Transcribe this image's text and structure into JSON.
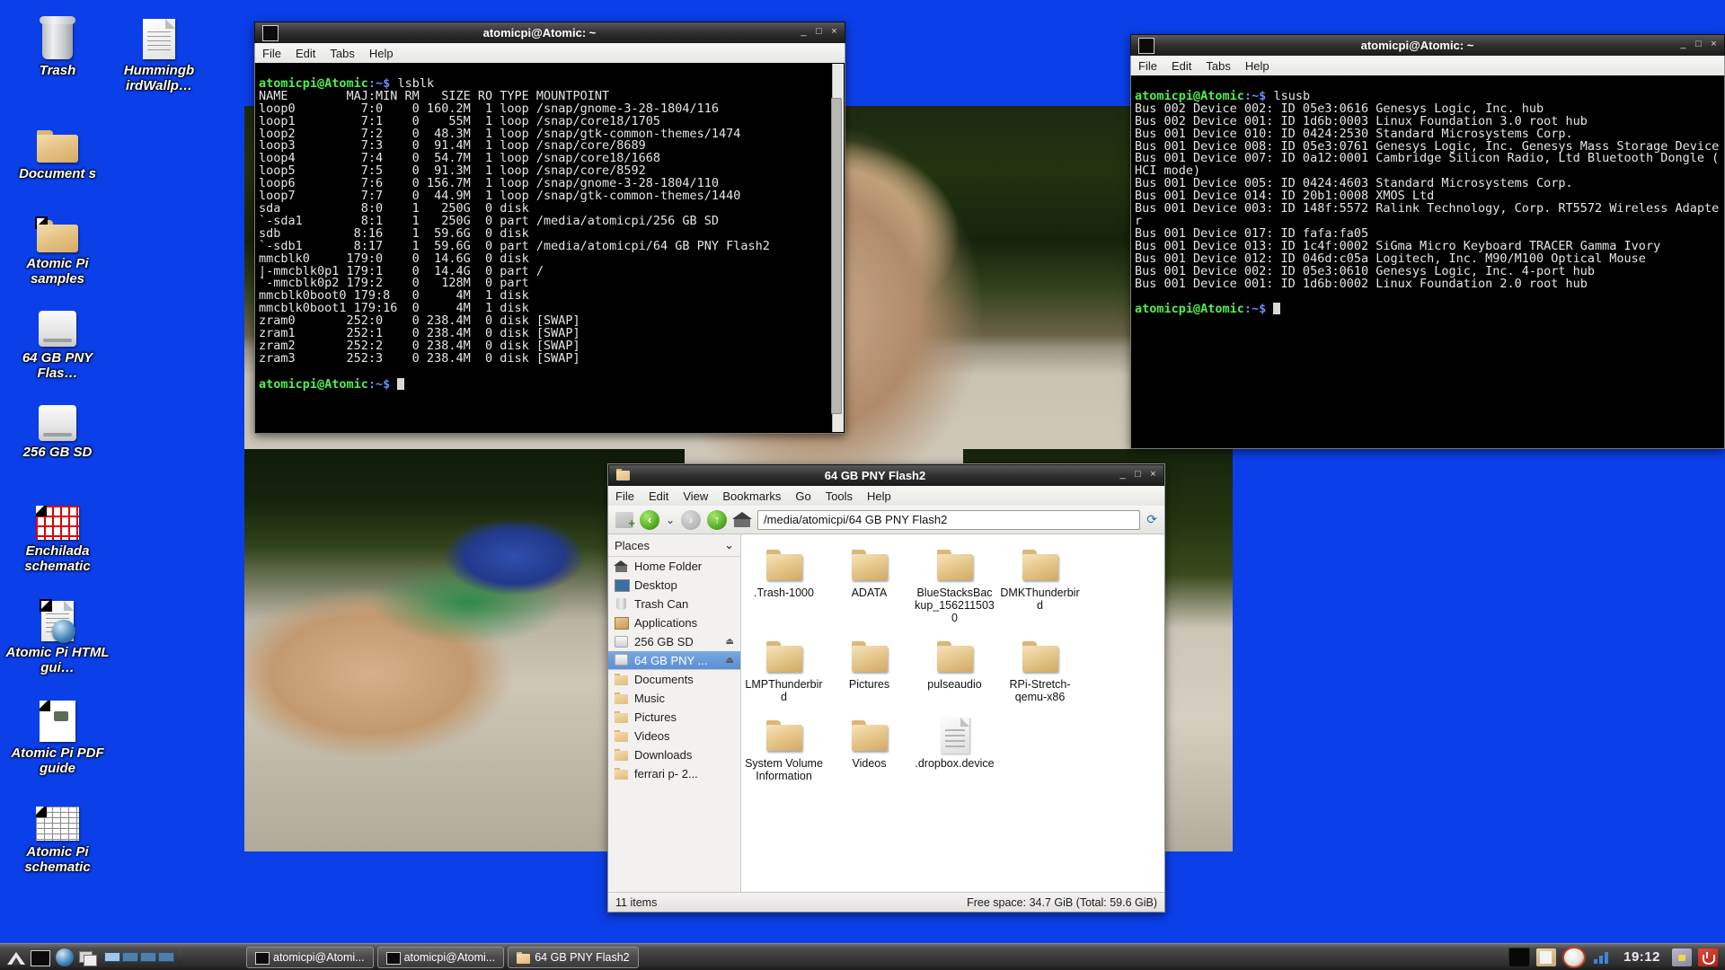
{
  "desktop": {
    "background_color": "#0b3fe8",
    "icons": [
      {
        "label": "Trash",
        "icon": "trash-icon",
        "type": "trash"
      },
      {
        "label": "Hummingb irdWallp…",
        "icon": "document-icon",
        "type": "page"
      },
      {
        "label": "Document s",
        "icon": "folder-icon",
        "type": "folder"
      },
      {
        "label": "Atomic Pi samples",
        "icon": "folder-icon",
        "type": "folder",
        "shortcut": true
      },
      {
        "label": "64 GB PNY Flas…",
        "icon": "drive-icon",
        "type": "drive"
      },
      {
        "label": "256 GB SD",
        "icon": "drive-icon",
        "type": "drive"
      },
      {
        "label": "Enchilada schematic",
        "icon": "schematic-icon",
        "type": "schematic",
        "shortcut": true
      },
      {
        "label": "Atomic Pi HTML gui…",
        "icon": "html-document-icon",
        "type": "html",
        "shortcut": true
      },
      {
        "label": "Atomic Pi PDF guide",
        "icon": "pdf-icon",
        "type": "pdf",
        "shortcut": true
      },
      {
        "label": "Atomic Pi schematic",
        "icon": "schematic-icon",
        "type": "table",
        "shortcut": true
      }
    ]
  },
  "terminal1": {
    "title": "atomicpi@Atomic: ~",
    "icon": "terminal-icon",
    "menus": [
      "File",
      "Edit",
      "Tabs",
      "Help"
    ],
    "buttons": {
      "minimize": "_",
      "maximize": "□",
      "close": "×"
    },
    "prompt_user": "atomicpi@Atomic",
    "prompt_path": ":~$",
    "command": "lsblk",
    "output": [
      "NAME        MAJ:MIN RM   SIZE RO TYPE MOUNTPOINT",
      "loop0         7:0    0 160.2M  1 loop /snap/gnome-3-28-1804/116",
      "loop1         7:1    0    55M  1 loop /snap/core18/1705",
      "loop2         7:2    0  48.3M  1 loop /snap/gtk-common-themes/1474",
      "loop3         7:3    0  91.4M  1 loop /snap/core/8689",
      "loop4         7:4    0  54.7M  1 loop /snap/core18/1668",
      "loop5         7:5    0  91.3M  1 loop /snap/core/8592",
      "loop6         7:6    0 156.7M  1 loop /snap/gnome-3-28-1804/110",
      "loop7         7:7    0  44.9M  1 loop /snap/gtk-common-themes/1440",
      "sda           8:0    1   250G  0 disk",
      "`-sda1        8:1    1   250G  0 part /media/atomicpi/256 GB SD",
      "sdb          8:16    1  59.6G  0 disk",
      "`-sdb1       8:17    1  59.6G  0 part /media/atomicpi/64 GB PNY Flash2",
      "mmcblk0     179:0    0  14.6G  0 disk",
      "|-mmcblk0p1 179:1    0  14.4G  0 part /",
      "`-mmcblk0p2 179:2    0   128M  0 part",
      "mmcblk0boot0 179:8   0     4M  1 disk",
      "mmcblk0boot1 179:16  0     4M  1 disk",
      "zram0       252:0    0 238.4M  0 disk [SWAP]",
      "zram1       252:1    0 238.4M  0 disk [SWAP]",
      "zram2       252:2    0 238.4M  0 disk [SWAP]",
      "zram3       252:3    0 238.4M  0 disk [SWAP]"
    ]
  },
  "terminal2": {
    "title": "atomicpi@Atomic: ~",
    "icon": "terminal-icon",
    "menus": [
      "File",
      "Edit",
      "Tabs",
      "Help"
    ],
    "buttons": {
      "minimize": "_",
      "maximize": "□",
      "close": "×"
    },
    "prompt_user": "atomicpi@Atomic",
    "prompt_path": ":~$",
    "command": "lsusb",
    "output": [
      "Bus 002 Device 002: ID 05e3:0616 Genesys Logic, Inc. hub",
      "Bus 002 Device 001: ID 1d6b:0003 Linux Foundation 3.0 root hub",
      "Bus 001 Device 010: ID 0424:2530 Standard Microsystems Corp.",
      "Bus 001 Device 008: ID 05e3:0761 Genesys Logic, Inc. Genesys Mass Storage Device",
      "Bus 001 Device 007: ID 0a12:0001 Cambridge Silicon Radio, Ltd Bluetooth Dongle (",
      "HCI mode)",
      "Bus 001 Device 005: ID 0424:4603 Standard Microsystems Corp.",
      "Bus 001 Device 014: ID 20b1:0008 XMOS Ltd",
      "Bus 001 Device 003: ID 148f:5572 Ralink Technology, Corp. RT5572 Wireless Adapte",
      "r",
      "Bus 001 Device 017: ID fafa:fa05",
      "Bus 001 Device 013: ID 1c4f:0002 SiGma Micro Keyboard TRACER Gamma Ivory",
      "Bus 001 Device 012: ID 046d:c05a Logitech, Inc. M90/M100 Optical Mouse",
      "Bus 001 Device 002: ID 05e3:0610 Genesys Logic, Inc. 4-port hub",
      "Bus 001 Device 001: ID 1d6b:0002 Linux Foundation 2.0 root hub"
    ]
  },
  "filemanager": {
    "title": "64 GB PNY Flash2",
    "icon": "folder-icon",
    "buttons": {
      "minimize": "_",
      "maximize": "□",
      "close": "×"
    },
    "menus": [
      "File",
      "Edit",
      "View",
      "Bookmarks",
      "Go",
      "Tools",
      "Help"
    ],
    "toolbar": {
      "new_tab_icon": "new-tab-icon",
      "back_icon": "back-icon",
      "history_icon": "chevron-down-icon",
      "forward_icon": "forward-icon",
      "up_icon": "up-icon",
      "home_icon": "home-icon",
      "refresh_icon": "refresh-icon"
    },
    "path": "/media/atomicpi/64 GB PNY Flash2",
    "places_header": "Places",
    "places": [
      {
        "label": "Home Folder",
        "icon": "home-icon",
        "eject": false
      },
      {
        "label": "Desktop",
        "icon": "desktop-icon",
        "eject": false
      },
      {
        "label": "Trash Can",
        "icon": "trash-icon",
        "eject": false
      },
      {
        "label": "Applications",
        "icon": "applications-icon",
        "eject": false
      },
      {
        "label": "256 GB SD",
        "icon": "drive-icon",
        "eject": true
      },
      {
        "label": "64 GB PNY ...",
        "icon": "drive-icon",
        "eject": true,
        "selected": true
      },
      {
        "label": "Documents",
        "icon": "folder-icon",
        "eject": false
      },
      {
        "label": "Music",
        "icon": "folder-icon",
        "eject": false
      },
      {
        "label": "Pictures",
        "icon": "folder-icon",
        "eject": false
      },
      {
        "label": "Videos",
        "icon": "folder-icon",
        "eject": false
      },
      {
        "label": "Downloads",
        "icon": "folder-icon",
        "eject": false
      },
      {
        "label": "ferrari p-  2...",
        "icon": "folder-icon",
        "eject": false
      }
    ],
    "files": [
      {
        "name": ".Trash-1000",
        "type": "folder"
      },
      {
        "name": "ADATA",
        "type": "folder"
      },
      {
        "name": "BlueStacksBackup_1562115030",
        "type": "folder"
      },
      {
        "name": "DMKThunderbird",
        "type": "folder"
      },
      {
        "name": "LMPThunderbird",
        "type": "folder"
      },
      {
        "name": "Pictures",
        "type": "folder"
      },
      {
        "name": "pulseaudio",
        "type": "folder"
      },
      {
        "name": "RPi-Stretch-qemu-x86",
        "type": "folder"
      },
      {
        "name": "System Volume Information",
        "type": "folder"
      },
      {
        "name": "Videos",
        "type": "folder"
      },
      {
        "name": ".dropbox.device",
        "type": "file"
      }
    ],
    "status_left": "11 items",
    "status_right": "Free space: 34.7 GiB (Total: 59.6 GiB)"
  },
  "taskbar": {
    "launchers": [
      {
        "name": "menu-icon"
      },
      {
        "name": "terminal-launcher-icon"
      },
      {
        "name": "browser-launcher-icon"
      },
      {
        "name": "windows-launcher-icon"
      }
    ],
    "pager": {
      "name": "workspace-pager",
      "pages": 4,
      "active": 1
    },
    "windows": [
      {
        "label": "atomicpi@Atomi...",
        "icon": "terminal-icon"
      },
      {
        "label": "atomicpi@Atomi...",
        "icon": "terminal-icon"
      },
      {
        "label": "64 GB PNY Flash2",
        "icon": "folder-icon"
      }
    ],
    "tray": [
      {
        "name": "tray-monitor-icon"
      },
      {
        "name": "tray-clipboard-icon"
      },
      {
        "name": "tray-alarm-icon"
      },
      {
        "name": "tray-network-icon"
      }
    ],
    "clock": "19:12",
    "lock_icon": "lock-screen-icon",
    "power_icon": "power-icon"
  }
}
